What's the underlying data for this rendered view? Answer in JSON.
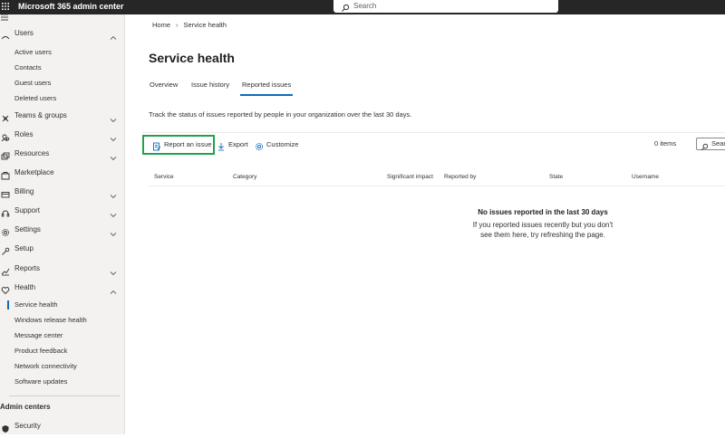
{
  "topbar": {
    "title": "Microsoft 365 admin center",
    "search_placeholder": "Search"
  },
  "sidebar": {
    "users_label": "Users",
    "users_sub": [
      "Active users",
      "Contacts",
      "Guest users",
      "Deleted users"
    ],
    "items": [
      {
        "label": "Teams & groups",
        "icon": "teams-groups-icon"
      },
      {
        "label": "Roles",
        "icon": "roles-icon"
      },
      {
        "label": "Resources",
        "icon": "resources-icon"
      },
      {
        "label": "Marketplace",
        "icon": "marketplace-icon"
      },
      {
        "label": "Billing",
        "icon": "billing-icon"
      },
      {
        "label": "Support",
        "icon": "support-icon"
      },
      {
        "label": "Settings",
        "icon": "settings-icon"
      },
      {
        "label": "Setup",
        "icon": "setup-icon"
      },
      {
        "label": "Reports",
        "icon": "reports-icon"
      },
      {
        "label": "Health",
        "icon": "health-icon"
      }
    ],
    "health_sub": [
      "Service health",
      "Windows release health",
      "Message center",
      "Product feedback",
      "Network connectivity",
      "Software updates"
    ],
    "admin_centers_label": "Admin centers",
    "security_label": "Security"
  },
  "breadcrumb": {
    "home": "Home",
    "current": "Service health"
  },
  "page": {
    "title": "Service health",
    "tabs": [
      "Overview",
      "Issue history",
      "Reported issues"
    ],
    "active_tab": "Reported issues",
    "description": "Track the status of issues reported by people in your organization over the last 30 days."
  },
  "commands": {
    "report": "Report an issue",
    "export": "Export",
    "customize": "Customize",
    "items_count": "0 items",
    "search_placeholder": "Search"
  },
  "table": {
    "columns": [
      "Service",
      "Category",
      "Significant impact",
      "Reported by",
      "State",
      "Username"
    ]
  },
  "empty_state": {
    "title": "No issues reported in the last 30 days",
    "body": "If you reported issues recently but you don't see them here, try refreshing the page."
  },
  "colors": {
    "topbar": "#262626",
    "accent": "#0f6cbd",
    "highlight": "#1fa34a",
    "sidebar_bg": "#f3f2f1"
  }
}
